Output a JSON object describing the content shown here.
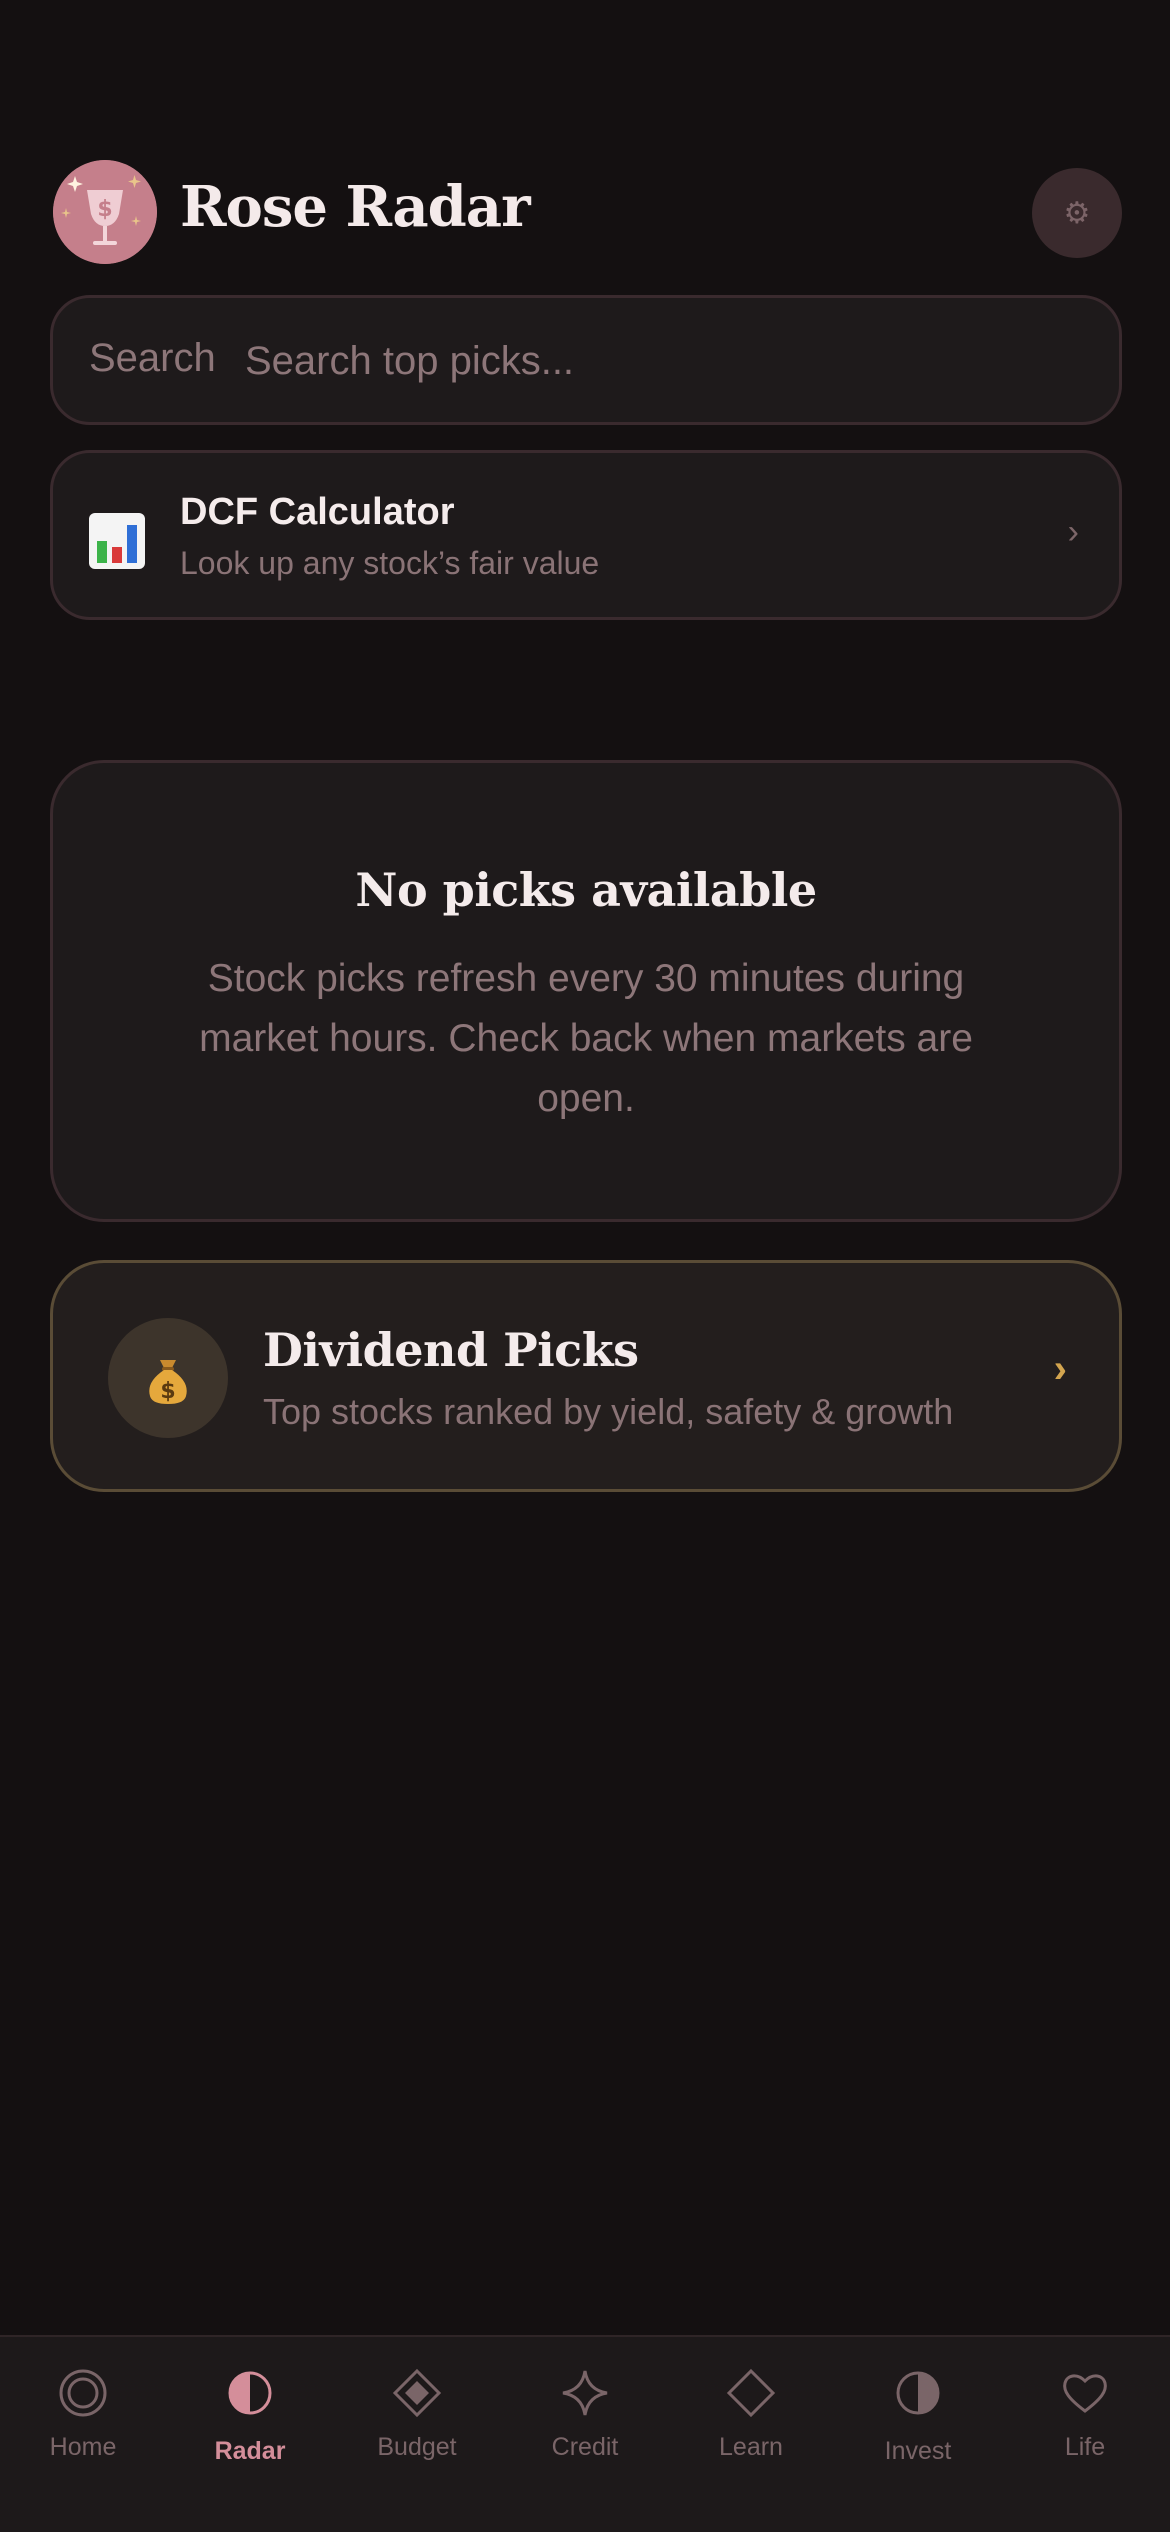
{
  "app": {
    "title": "Rose Radar",
    "accent": "#c57f8b",
    "background": "#141011"
  },
  "header": {
    "logo_icon": "wine-glass-dollar-icon",
    "settings_icon": "gear-icon"
  },
  "search": {
    "label": "Search",
    "placeholder": "Search top picks...",
    "value": ""
  },
  "dcf_card": {
    "icon": "bar-chart-icon",
    "title": "DCF Calculator",
    "subtitle": "Look up any stock’s fair value",
    "chevron": "›"
  },
  "empty_state": {
    "title": "No picks available",
    "message": "Stock picks refresh every 30 minutes during market hours. Check back when markets are open."
  },
  "dividend_card": {
    "icon": "money-bag-icon",
    "title": "Dividend Picks",
    "subtitle": "Top stocks ranked by yield, safety & growth",
    "chevron": "›",
    "accent": "#d3a54f"
  },
  "nav": {
    "active": "Radar",
    "items": [
      {
        "label": "Home",
        "icon": "ring-icon"
      },
      {
        "label": "Radar",
        "icon": "half-circle-icon"
      },
      {
        "label": "Budget",
        "icon": "diamond-icon"
      },
      {
        "label": "Credit",
        "icon": "sparkle-star-icon"
      },
      {
        "label": "Learn",
        "icon": "diamond-outline-icon"
      },
      {
        "label": "Invest",
        "icon": "half-circle-icon"
      },
      {
        "label": "Life",
        "icon": "heart-icon"
      }
    ]
  }
}
